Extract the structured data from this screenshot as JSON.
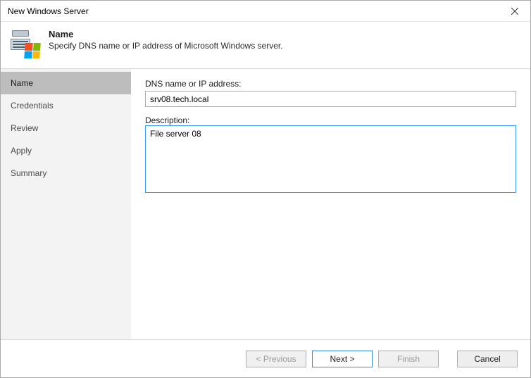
{
  "window": {
    "title": "New Windows Server"
  },
  "header": {
    "heading": "Name",
    "subheading": "Specify DNS name or IP address of Microsoft Windows server."
  },
  "sidebar": {
    "items": [
      {
        "label": "Name",
        "active": true
      },
      {
        "label": "Credentials",
        "active": false
      },
      {
        "label": "Review",
        "active": false
      },
      {
        "label": "Apply",
        "active": false
      },
      {
        "label": "Summary",
        "active": false
      }
    ]
  },
  "form": {
    "dns_label": "DNS name or IP address:",
    "dns_value": "srv08.tech.local",
    "desc_label": "Description:",
    "desc_value": "File server 08"
  },
  "footer": {
    "previous": "< Previous",
    "next": "Next >",
    "finish": "Finish",
    "cancel": "Cancel"
  }
}
